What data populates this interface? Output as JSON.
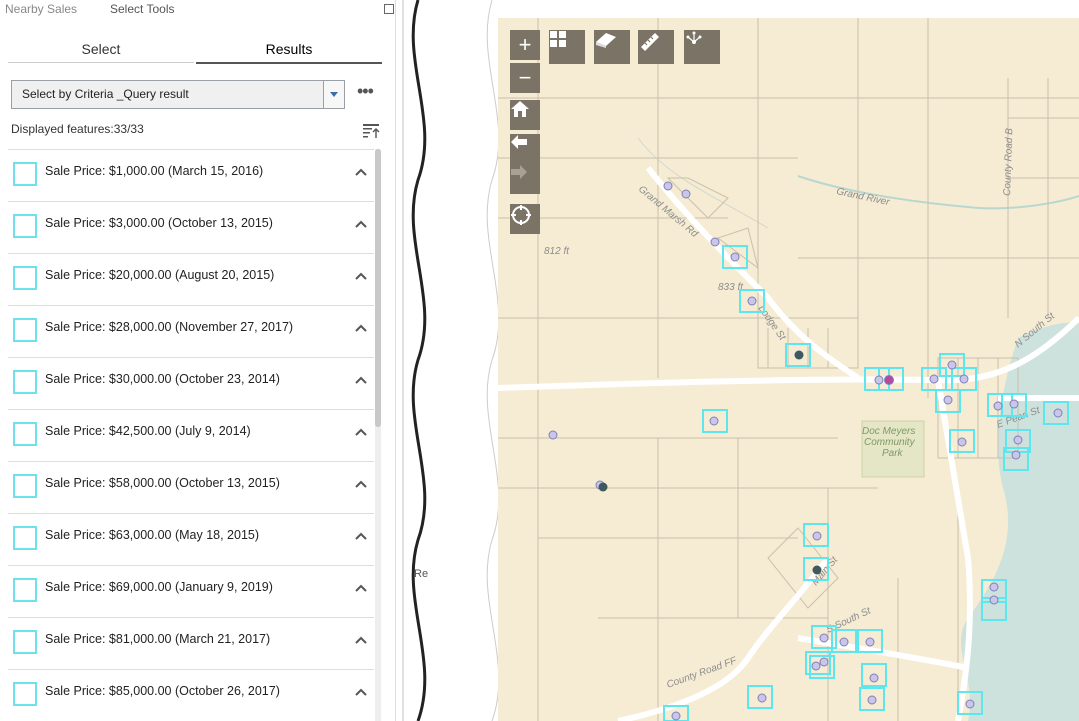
{
  "header": {
    "tab_nearby": "Nearby Sales",
    "tab_select": "Select Tools"
  },
  "tabs": {
    "select": "Select",
    "results": "Results"
  },
  "layer_select": {
    "value": "Select by Criteria _Query result"
  },
  "more_label": "•••",
  "displayed": "Displayed features:33/33",
  "results": [
    "Sale Price: $1,000.00 (March 15, 2016)",
    "Sale Price: $3,000.00 (October 13, 2015)",
    "Sale Price: $20,000.00 (August 20, 2015)",
    "Sale Price: $28,000.00 (November 27, 2017)",
    "Sale Price: $30,000.00 (October 23, 2014)",
    "Sale Price: $42,500.00 (July 9, 2014)",
    "Sale Price: $58,000.00 (October 13, 2015)",
    "Sale Price: $63,000.00 (May 18, 2015)",
    "Sale Price: $69,000.00 (January 9, 2019)",
    "Sale Price: $81,000.00 (March 21, 2017)",
    "Sale Price: $85,000.00 (October 26, 2017)"
  ],
  "strip_fragment": "Re",
  "map": {
    "labels": {
      "road_marsh": "Grand Marsh Rd",
      "river": "Grand River",
      "road_b": "County Road B",
      "elev_812": "812 ft",
      "elev_833": "833 ft",
      "road_lodge": "Lodge St",
      "road_n": "N South St",
      "park_1": "Doc Meyers",
      "park_2": "Community",
      "park_3": "Park",
      "road_main": "Main St",
      "road_s": "S South St",
      "road_ff": "County Road FF",
      "road_pearl": "E Pearl St"
    },
    "zoom_in": "+",
    "zoom_out": "−",
    "icons": [
      "home-icon",
      "back-arrow-icon",
      "forward-arrow-icon",
      "locate-icon",
      "basemap-gallery-icon",
      "eraser-icon",
      "measure-icon",
      "share-icon"
    ]
  },
  "colors": {
    "map_bg": "#f6ecd3",
    "parcel_line": "#c9c0ac",
    "road": "#ffffff",
    "water": "#cde2dd",
    "park": "#e4e6c5",
    "highlight": "#5ee6ee",
    "point_fill": "#c9c6ea",
    "point_stroke": "#7f7fb8",
    "point_dark": "#3f5a5f",
    "point_selected": "#b44aa0",
    "button": "#7b7466"
  }
}
